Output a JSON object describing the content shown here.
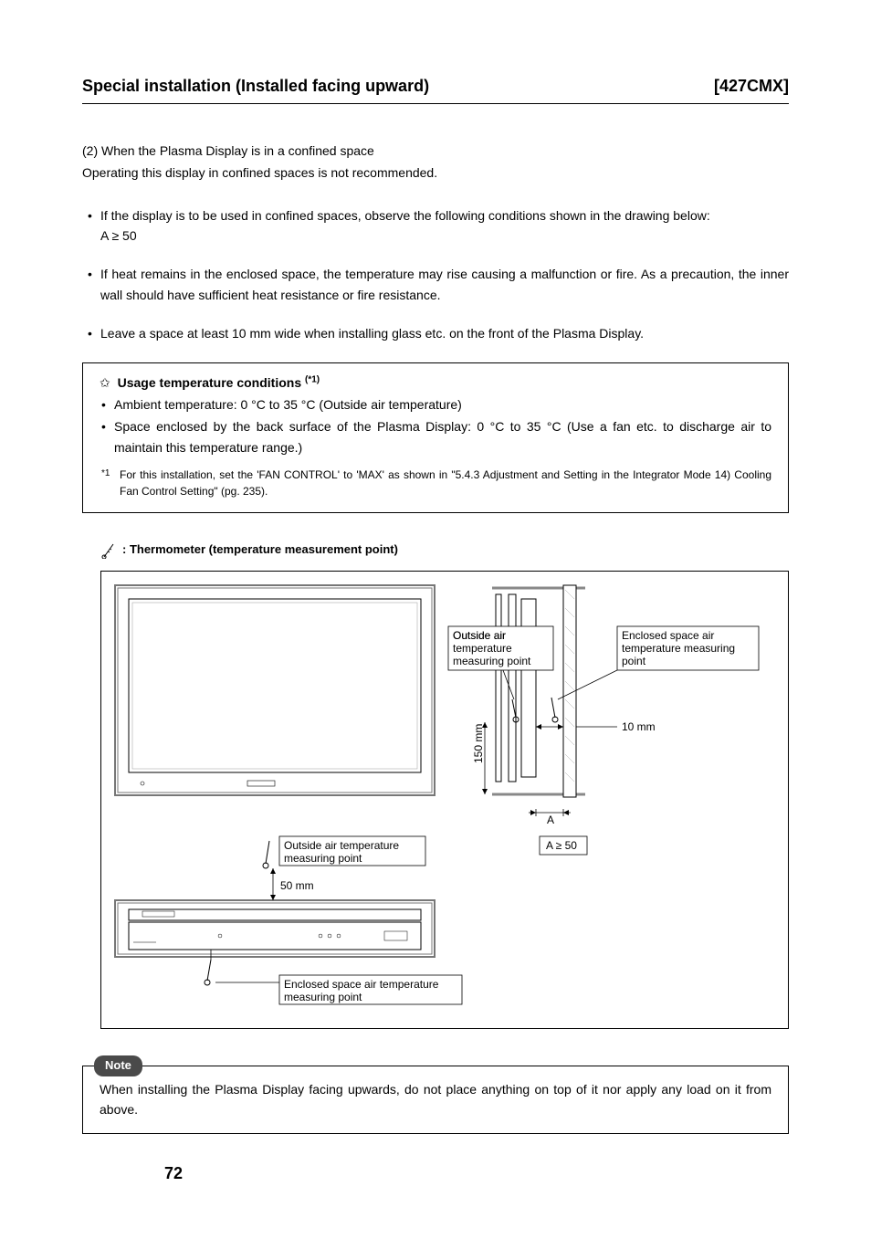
{
  "header": {
    "title": "Special installation (Installed facing upward)",
    "model": "[427CMX]"
  },
  "intro": {
    "line1": "(2) When the Plasma Display is in a confined space",
    "line2": "Operating this display in confined spaces is not recommended."
  },
  "bullets": {
    "b1": "If the display is to be used in confined spaces, observe the following conditions shown in the drawing below:",
    "b1sub": "A ≥ 50",
    "b2": "If heat remains in the enclosed space, the temperature may rise causing a malfunction or fire. As a precaution, the inner wall should have sufficient heat resistance or fire resistance.",
    "b3": "Leave a space at least 10 mm wide when installing glass etc. on the front of the Plasma Display."
  },
  "framed": {
    "title": "Usage temperature conditions",
    "supref": "(*1)",
    "fb1": "Ambient temperature: 0 °C to 35 °C (Outside air temperature)",
    "fb2": "Space enclosed by the back surface of the Plasma Display: 0 °C to 35 °C (Use a fan etc. to discharge air to maintain this temperature range.)",
    "fn_mark": "*1",
    "fn_text": "For this installation, set the 'FAN CONTROL' to 'MAX' as shown in \"5.4.3 Adjustment and Setting in the Integrator Mode 14) Cooling Fan Control Setting\" (pg. 235)."
  },
  "thermo_legend": ": Thermometer (temperature measurement point)",
  "diagram": {
    "label_outside_air_top": "Outside air temperature measuring point",
    "label_enclosed_top": "Enclosed space air temperature measuring point",
    "label_10mm": "10 mm",
    "label_150mm": "150 mm",
    "label_A": "A",
    "label_A_cond": "A ≥ 50",
    "label_outside_bottom": "Outside air temperature measuring point",
    "label_50mm": "50 mm",
    "label_enclosed_bottom": "Enclosed space air temperature measuring point"
  },
  "note": {
    "label": "Note",
    "text": "When installing the Plasma Display facing upwards, do not place anything on top of it nor apply any load on it from above."
  },
  "page_number": "72"
}
